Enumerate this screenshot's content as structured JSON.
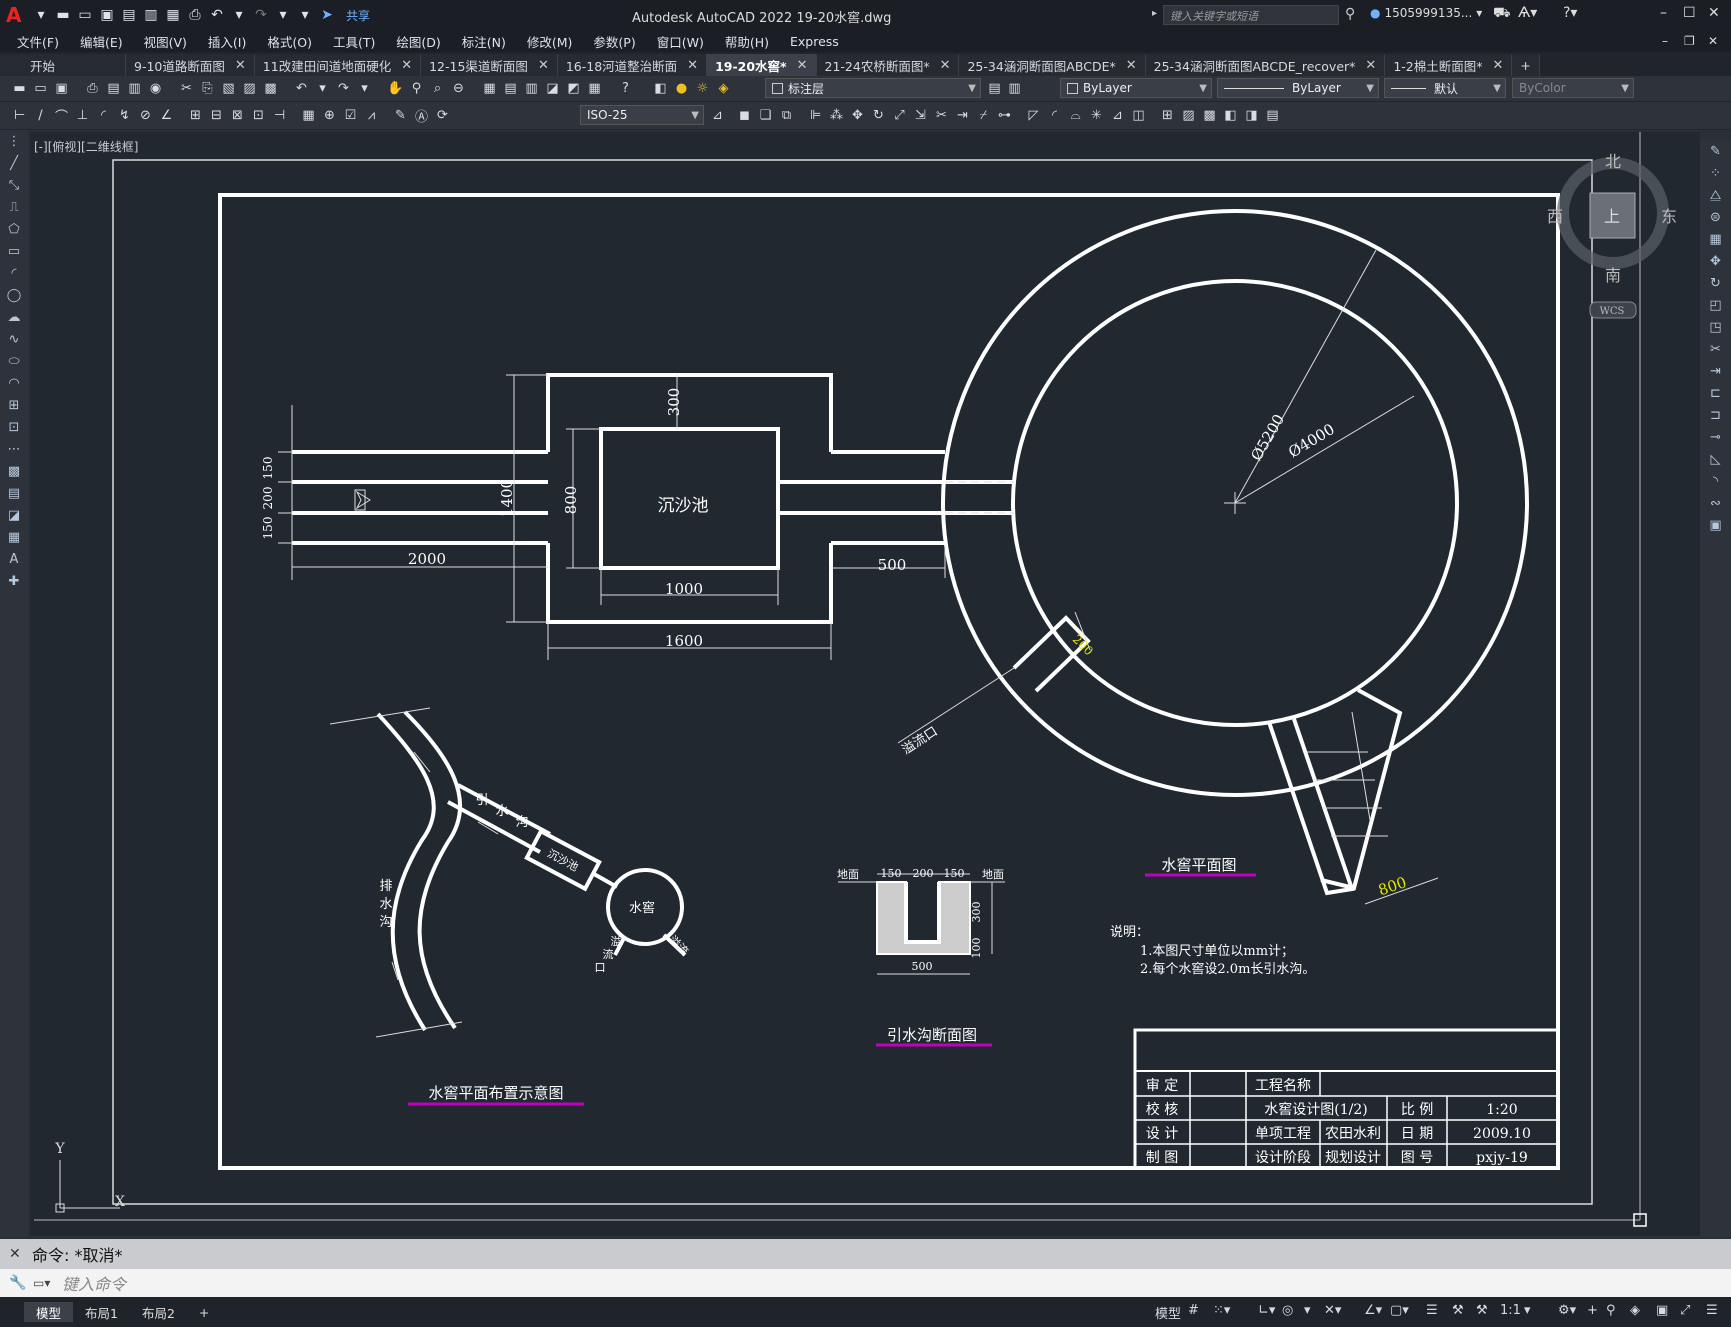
{
  "app": {
    "title": "Autodesk AutoCAD 2022    19-20水窖.dwg",
    "search_placeholder": "键入关键字或短语",
    "user": "1505999135...",
    "share_label": "共享"
  },
  "menu": [
    "文件(F)",
    "编辑(E)",
    "视图(V)",
    "插入(I)",
    "格式(O)",
    "工具(T)",
    "绘图(D)",
    "标注(N)",
    "修改(M)",
    "参数(P)",
    "窗口(W)",
    "帮助(H)",
    "Express"
  ],
  "tabs": [
    {
      "label": "开始",
      "closable": false,
      "active": false
    },
    {
      "label": "9-10道路断面图",
      "closable": true,
      "active": false
    },
    {
      "label": "11改建田间道地面硬化",
      "closable": true,
      "active": false
    },
    {
      "label": "12-15渠道断面图",
      "closable": true,
      "active": false
    },
    {
      "label": "16-18河道整治断面",
      "closable": true,
      "active": false
    },
    {
      "label": "19-20水窖*",
      "closable": true,
      "active": true
    },
    {
      "label": "21-24农桥断面图*",
      "closable": true,
      "active": false
    },
    {
      "label": "25-34涵洞断面图ABCDE*",
      "closable": true,
      "active": false
    },
    {
      "label": "25-34涵洞断面图ABCDE_recover*",
      "closable": true,
      "active": false
    },
    {
      "label": "1-2棉土断面图*",
      "closable": true,
      "active": false
    }
  ],
  "toolbar": {
    "layer": "标注层",
    "color": "ByLayer",
    "linetype": "ByLayer",
    "lineweight": "默认",
    "plotstyle": "ByColor",
    "dimstyle": "ISO-25"
  },
  "viewport_label": "[-][俯视][二维线框]",
  "viewcube": {
    "north": "北",
    "south": "南",
    "east": "东",
    "west": "西",
    "top": "上",
    "wcs": "WCS"
  },
  "drawing": {
    "plan_view": {
      "settling_tank": "沉沙池",
      "dims": {
        "d300": "300",
        "d800": "800",
        "d1400": "1400",
        "d150a": "150",
        "d200": "200",
        "d150b": "150",
        "d2000": "2000",
        "d1000": "1000",
        "d1600": "1600",
        "d500": "500",
        "dia5200": "Ø5200",
        "dia4000": "Ø4000",
        "d200b": "200",
        "d800b": "800"
      },
      "overflow": "溢流口",
      "title": "水窖平面图"
    },
    "layout_view": {
      "drain": [
        "排",
        "水",
        "沟"
      ],
      "intake": [
        "引",
        "水",
        "沟"
      ],
      "settling": "沉沙池",
      "cistern": "水窖",
      "overflow1": [
        "溢",
        "流",
        "口"
      ],
      "overflow2": "溢流",
      "title": "水窖平面布置示意图"
    },
    "section_view": {
      "ground_left": "地面",
      "ground_right": "地面",
      "d150a": "150",
      "d200": "200",
      "d150b": "150",
      "d300": "300",
      "d100": "100",
      "d500": "500",
      "title": "引水沟断面图"
    },
    "notes": {
      "heading": "说明：",
      "line1": "1.本图尺寸单位以mm计；",
      "line2": "2.每个水窖设2.0m长引水沟。"
    },
    "title_block": {
      "r1": [
        "审 定",
        "",
        "工程名称",
        ""
      ],
      "r2": [
        "校 核",
        "",
        "水窖设计图(1/2)",
        "比 例",
        "1:20"
      ],
      "r3": [
        "设 计",
        "",
        "单项工程",
        "农田水利",
        "日 期",
        "2009.10"
      ],
      "r4": [
        "制 图",
        "",
        "设计阶段",
        "规划设计",
        "图 号",
        "pxjy-19"
      ]
    }
  },
  "command": {
    "history": "命令:  *取消*",
    "placeholder": "键入命令"
  },
  "status": {
    "model_tab": "模型",
    "layout1": "布局1",
    "layout2": "布局2",
    "model_btn": "模型",
    "scale": "1:1"
  },
  "colors": {
    "accent_magenta": "#c000c0",
    "dim_yellow": "#e6e600",
    "canvas": "#212830"
  }
}
